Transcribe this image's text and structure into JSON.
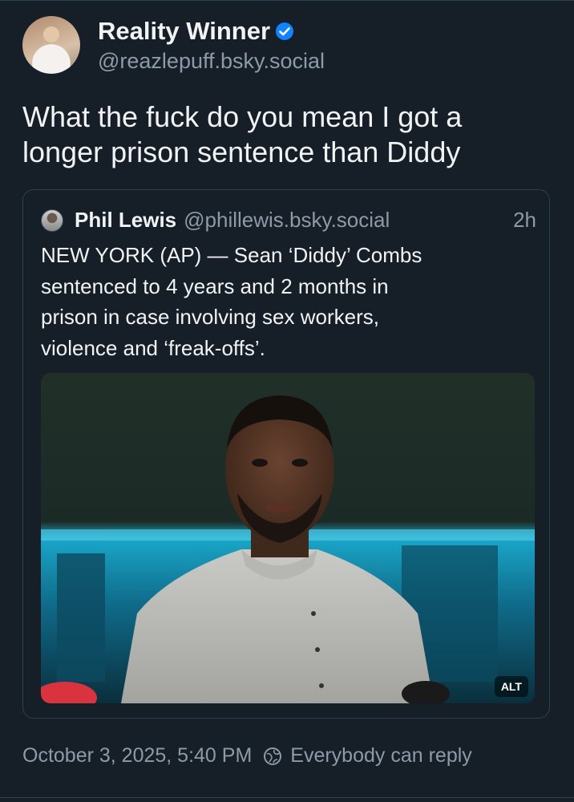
{
  "post": {
    "author": {
      "display_name": "Reality Winner",
      "handle": "@reazlepuff.bsky.social",
      "verified": true
    },
    "text_line1": "What the fuck do you mean I got a",
    "text_line2": "longer prison sentence than Diddy",
    "timestamp": "October 3, 2025, 5:40 PM",
    "reply_setting": "Everybody can reply"
  },
  "quote": {
    "author": {
      "display_name": "Phil Lewis",
      "handle": "@phillewis.bsky.social"
    },
    "time": "2h",
    "text_lines": [
      "NEW YORK (AP) — Sean ‘Diddy’ Combs",
      "sentenced to 4 years and 2 months in",
      "prison in case involving sex workers,",
      "violence and ‘freak-offs’."
    ],
    "image": {
      "alt_badge": "ALT"
    }
  },
  "colors": {
    "background": "#161e27",
    "text": "#f1f3f5",
    "muted": "#8d9aa8",
    "border": "#2e4052",
    "verified": "#1083fe"
  }
}
